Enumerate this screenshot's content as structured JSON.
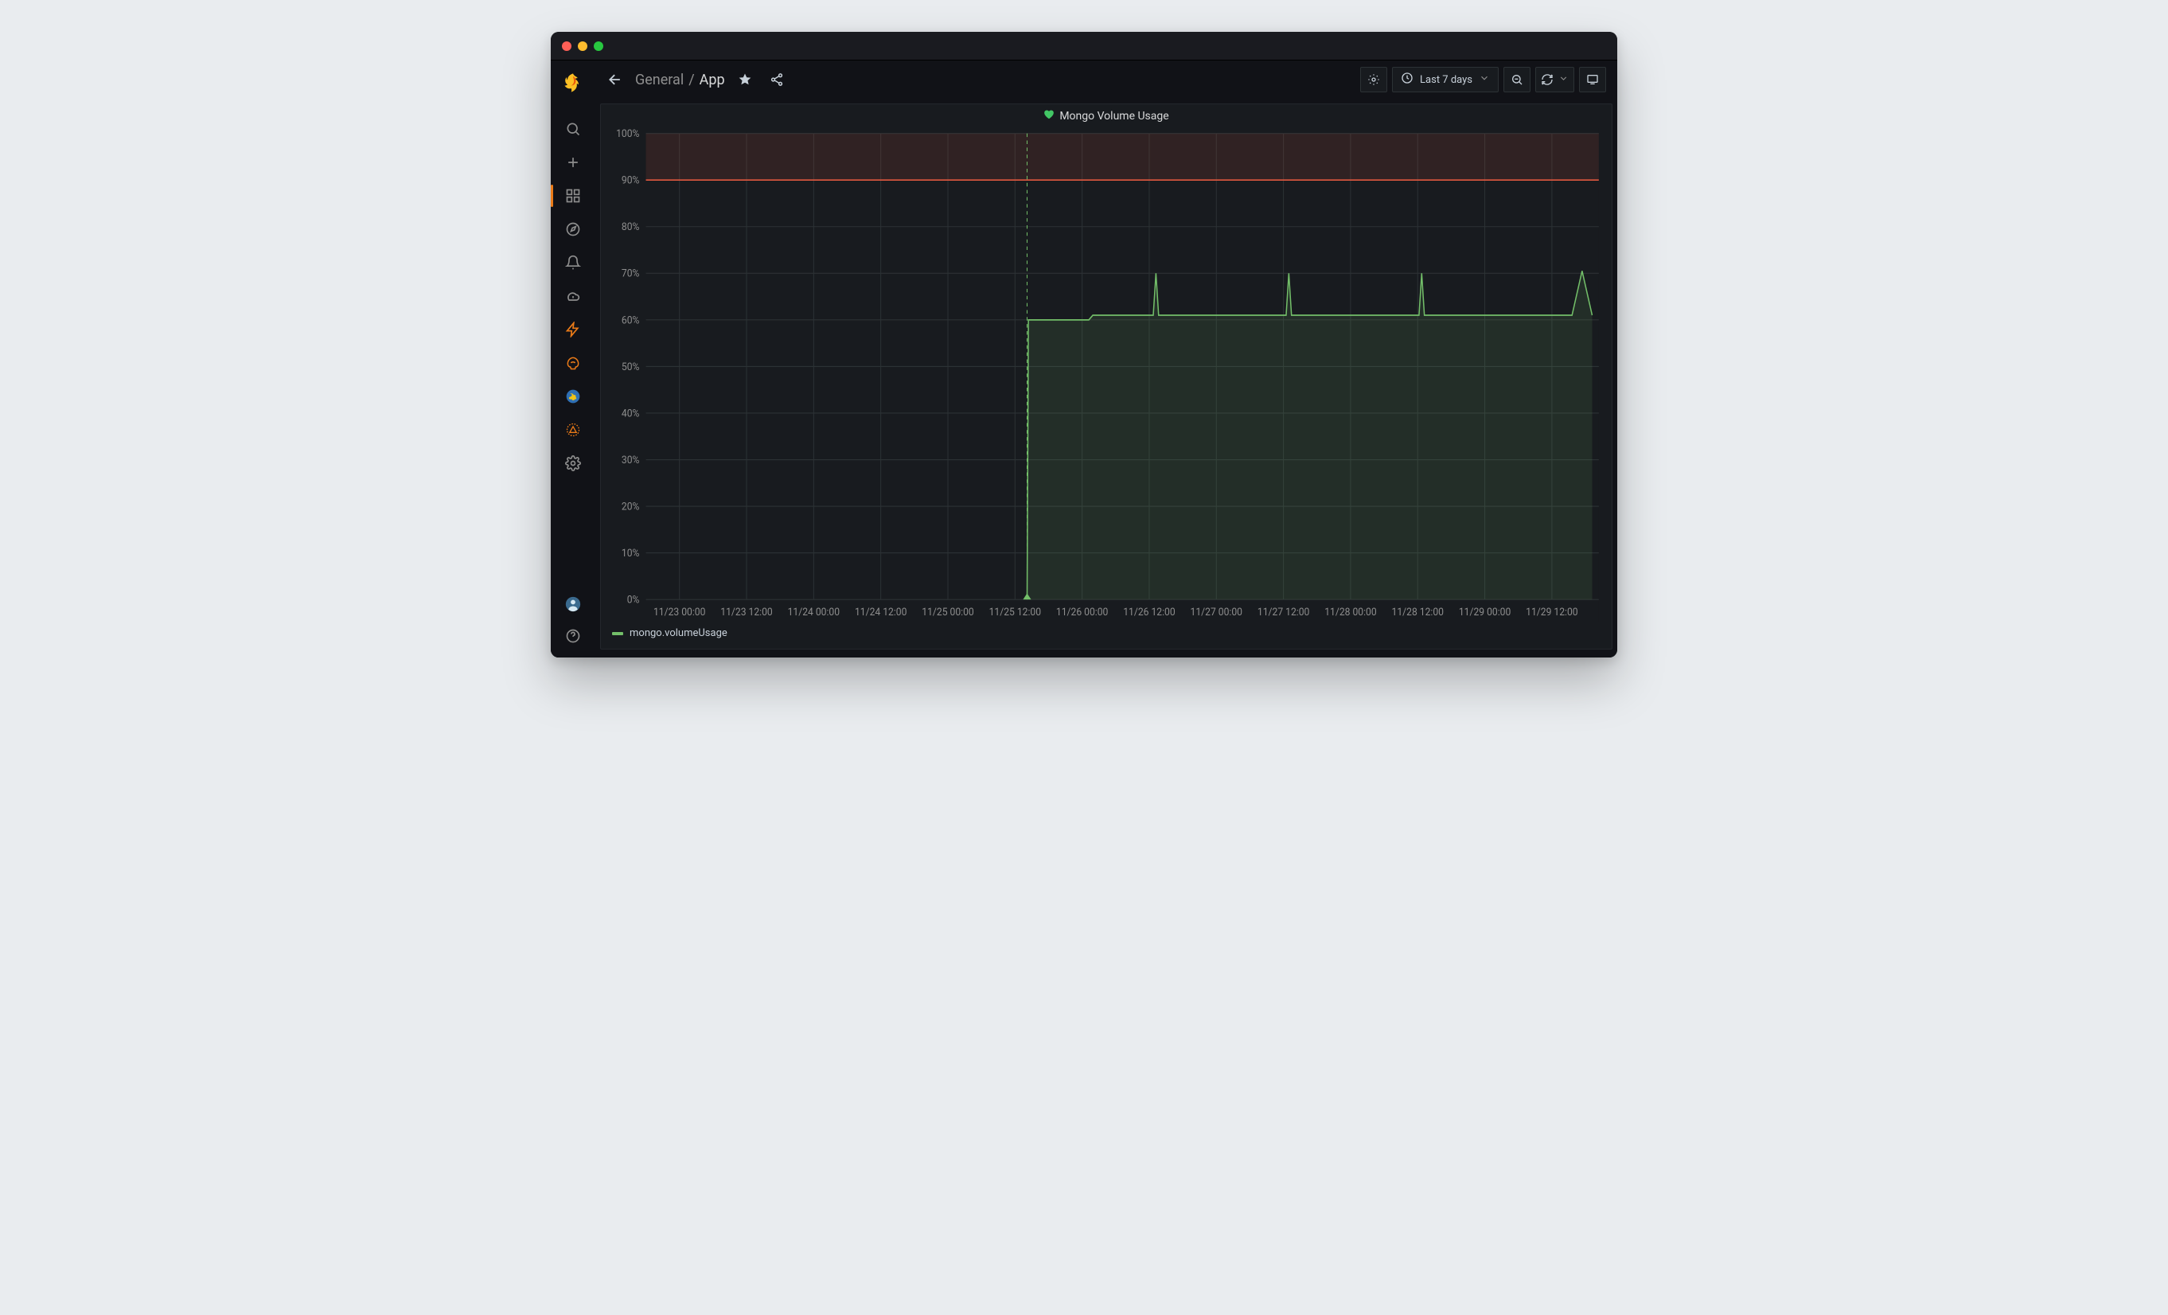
{
  "window": {
    "title": "Grafana"
  },
  "sidebar": {
    "items": [
      {
        "name": "search",
        "label": "Search"
      },
      {
        "name": "create",
        "label": "Create"
      },
      {
        "name": "dashboards",
        "label": "Dashboards",
        "active": true
      },
      {
        "name": "explore",
        "label": "Explore"
      },
      {
        "name": "alerting",
        "label": "Alerting"
      },
      {
        "name": "cloud",
        "label": "Cloud"
      },
      {
        "name": "admin-bolt",
        "label": "Admin Bolt"
      },
      {
        "name": "ai",
        "label": "AI"
      },
      {
        "name": "globe",
        "label": "Globe"
      },
      {
        "name": "pyramid",
        "label": "Pyramid"
      },
      {
        "name": "configuration",
        "label": "Configuration"
      }
    ],
    "bottom": [
      {
        "name": "profile",
        "label": "Profile"
      },
      {
        "name": "help",
        "label": "Help"
      }
    ]
  },
  "header": {
    "breadcrumb": {
      "folder": "General",
      "sep": "/",
      "page": "App"
    },
    "time_label": "Last 7 days"
  },
  "panel": {
    "title": "Mongo Volume Usage",
    "legend": "mongo.volumeUsage"
  },
  "chart_data": {
    "type": "line",
    "title": "Mongo Volume Usage",
    "ylabel": "",
    "xlabel": "",
    "ylim": [
      0,
      100
    ],
    "y_unit": "%",
    "y_ticks": [
      0,
      10,
      20,
      30,
      40,
      50,
      60,
      70,
      80,
      90,
      100
    ],
    "x_categories": [
      "11/23 00:00",
      "11/23 12:00",
      "11/24 00:00",
      "11/24 12:00",
      "11/25 00:00",
      "11/25 12:00",
      "11/26 00:00",
      "11/26 12:00",
      "11/27 00:00",
      "11/27 12:00",
      "11/28 00:00",
      "11/28 12:00",
      "11/29 00:00",
      "11/29 12:00"
    ],
    "threshold": {
      "value": 90,
      "fill_above": true,
      "color": "#e0583f"
    },
    "annotations": [
      {
        "x": 5.18,
        "label": ""
      }
    ],
    "series": [
      {
        "name": "mongo.volumeUsage",
        "color": "#73bf69",
        "fill": true,
        "points": [
          [
            5.18,
            0
          ],
          [
            5.2,
            60
          ],
          [
            6.1,
            60
          ],
          [
            6.16,
            61
          ],
          [
            7.06,
            61
          ],
          [
            7.1,
            70
          ],
          [
            7.14,
            61
          ],
          [
            9.04,
            61
          ],
          [
            9.08,
            70
          ],
          [
            9.12,
            61
          ],
          [
            11.02,
            61
          ],
          [
            11.06,
            70
          ],
          [
            11.1,
            61
          ],
          [
            13.3,
            61
          ],
          [
            13.45,
            70.5
          ],
          [
            13.6,
            61
          ]
        ]
      }
    ]
  }
}
